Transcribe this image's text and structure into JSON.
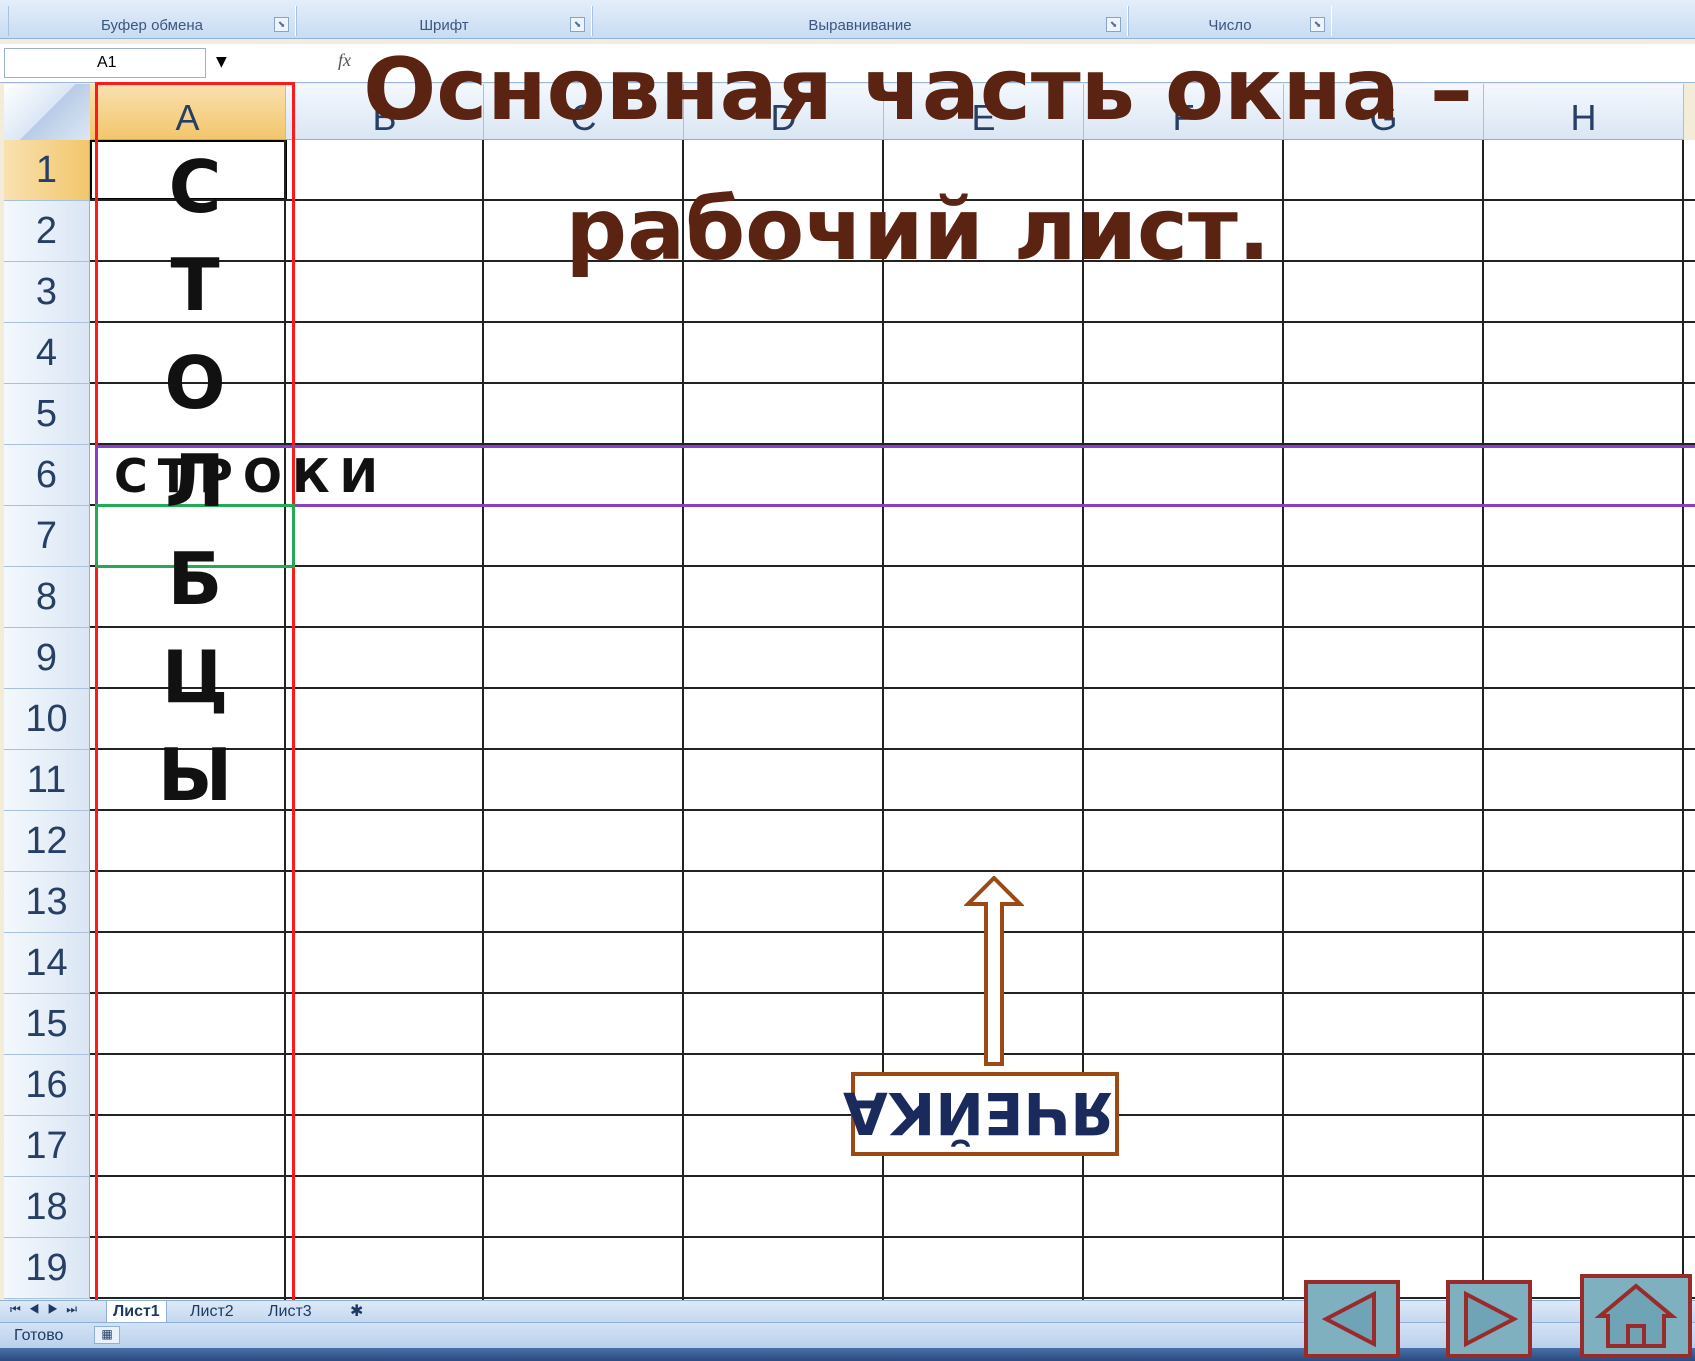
{
  "ribbon": {
    "groups": [
      {
        "label": "Буфер обмена"
      },
      {
        "label": "Шрифт"
      },
      {
        "label": "Выравнивание"
      },
      {
        "label": "Число"
      }
    ]
  },
  "formula_bar": {
    "name_box": "A1",
    "fx_label": "fx"
  },
  "title": "Основная часть окна – рабочий лист.",
  "columns": [
    "A",
    "B",
    "C",
    "D",
    "E",
    "F",
    "G",
    "H"
  ],
  "rows": [
    "1",
    "2",
    "3",
    "4",
    "5",
    "6",
    "7",
    "8",
    "9",
    "10",
    "11",
    "12",
    "13",
    "14",
    "15",
    "16",
    "17",
    "18",
    "19"
  ],
  "labels": {
    "columns_label_letters": [
      "С",
      "Т",
      "О",
      "Л",
      "Б",
      "Ц",
      "Ы"
    ],
    "rows_label": "СТРОКИ",
    "cell_label": "ЯЧЕЙКА"
  },
  "sheets": [
    "Лист1",
    "Лист2",
    "Лист3"
  ],
  "status": "Готово",
  "colors": {
    "title": "#5b2311",
    "column_frame": "#ff1a1a",
    "row_frame": "#8a3fc7",
    "cell_frame": "#22aa55",
    "arrow": "#9b4a15"
  },
  "nav_buttons": {
    "prev": "back-arrow-icon",
    "next": "forward-arrow-icon",
    "home": "home-icon"
  }
}
